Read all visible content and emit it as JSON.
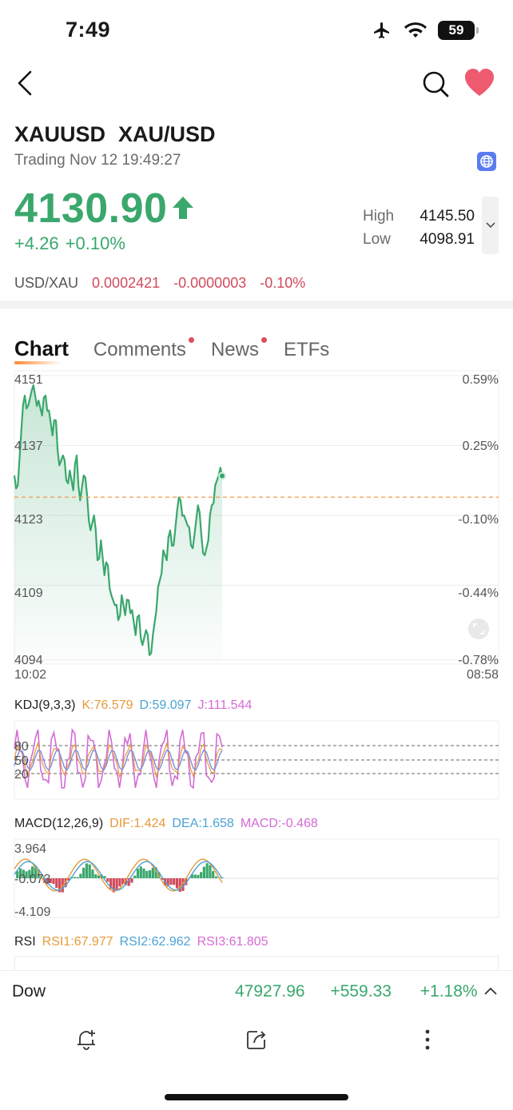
{
  "status_bar": {
    "time": "7:49",
    "battery": "59"
  },
  "header": {
    "symbol": "XAUUSD",
    "name": "XAU/USD",
    "trading_status": "Trading Nov 12 19:49:27"
  },
  "quote": {
    "price": "4130.90",
    "change": "+4.26",
    "change_pct": "+0.10%",
    "high_label": "High",
    "high_value": "4145.50",
    "low_label": "Low",
    "low_value": "4098.91",
    "up_color": "#3aa76d"
  },
  "inverse": {
    "label": "USD/XAU",
    "price": "0.0002421",
    "change": "-0.0000003",
    "change_pct": "-0.10%",
    "down_color": "#d24a5a"
  },
  "tabs": [
    {
      "label": "Chart",
      "active": true,
      "dot": false
    },
    {
      "label": "Comments",
      "active": false,
      "dot": true
    },
    {
      "label": "News",
      "active": false,
      "dot": true
    },
    {
      "label": "ETFs",
      "active": false,
      "dot": false
    }
  ],
  "chart_data": [
    {
      "type": "area",
      "ylim": [
        4094,
        4151
      ],
      "y_ticks_left": [
        "4151",
        "4137",
        "4123",
        "4109",
        "4094"
      ],
      "y_ticks_right": [
        "0.59%",
        "0.25%",
        "-0.10%",
        "-0.44%",
        "-0.78%"
      ],
      "x_start_label": "10:02",
      "x_end_label": "08:58",
      "reference_price": 4126.64,
      "values": [
        4131,
        4129,
        4140,
        4147,
        4145,
        4148,
        4147,
        4146,
        4143,
        4147,
        4144,
        4139,
        4142,
        4133,
        4135,
        4130,
        4132,
        4128,
        4135,
        4126,
        4131,
        4127,
        4120,
        4123,
        4114,
        4118,
        4111,
        4113,
        4107,
        4105,
        4102,
        4107,
        4103,
        4106,
        4104,
        4099,
        4103,
        4097,
        4100,
        4095,
        4099,
        4104,
        4110,
        4116,
        4114,
        4120,
        4117,
        4124,
        4126,
        4123,
        4121,
        4117,
        4119,
        4125,
        4119,
        4115,
        4118,
        4125,
        4129,
        4131,
        4130.9
      ],
      "line_color": "#3aa76d"
    },
    {
      "type": "line",
      "title": "KDJ(9,3,3)",
      "series": [
        {
          "name": "K",
          "value": "76.579",
          "color": "#e69a3c"
        },
        {
          "name": "D",
          "value": "59.097",
          "color": "#4ba3d6"
        },
        {
          "name": "J",
          "value": "111.544",
          "color": "#d46bd6"
        }
      ],
      "y_ticks": [
        "80",
        "50",
        "20"
      ]
    },
    {
      "type": "bar",
      "title": "MACD(12,26,9)",
      "series": [
        {
          "name": "DIF",
          "value": "1.424",
          "color": "#e69a3c"
        },
        {
          "name": "DEA",
          "value": "1.658",
          "color": "#4ba3d6"
        },
        {
          "name": "MACD",
          "value": "-0.468",
          "color": "#d46bd6"
        }
      ],
      "y_ticks": [
        "3.964",
        "-0.073",
        "-4.109"
      ]
    },
    {
      "type": "line",
      "title": "RSI",
      "series": [
        {
          "name": "RSI1",
          "value": "67.977",
          "color": "#e69a3c"
        },
        {
          "name": "RSI2",
          "value": "62.962",
          "color": "#4ba3d6"
        },
        {
          "name": "RSI3",
          "value": "61.805",
          "color": "#d46bd6"
        }
      ]
    }
  ],
  "kdj": {
    "title": "KDJ(9,3,3)",
    "k": "K:76.579",
    "d": "D:59.097",
    "j": "J:111.544",
    "y80": "80",
    "y50": "50",
    "y20": "20"
  },
  "macd": {
    "title": "MACD(12,26,9)",
    "dif": "DIF:1.424",
    "dea": "DEA:1.658",
    "macd": "MACD:-0.468",
    "ymax": "3.964",
    "ymid": "-0.073",
    "ymin": "-4.109"
  },
  "rsi": {
    "title": "RSI",
    "r1": "RSI1:67.977",
    "r2": "RSI2:62.962",
    "r3": "RSI3:61.805"
  },
  "ticker": {
    "name": "Dow",
    "value": "47927.96",
    "change": "+559.33",
    "change_pct": "+1.18%"
  },
  "icons": {
    "back": "chevron-left-icon",
    "search": "search-icon",
    "favorite": "heart-icon",
    "globe": "globe-icon",
    "alert": "bell-plus-icon",
    "share": "share-icon",
    "more": "more-vertical-icon"
  }
}
